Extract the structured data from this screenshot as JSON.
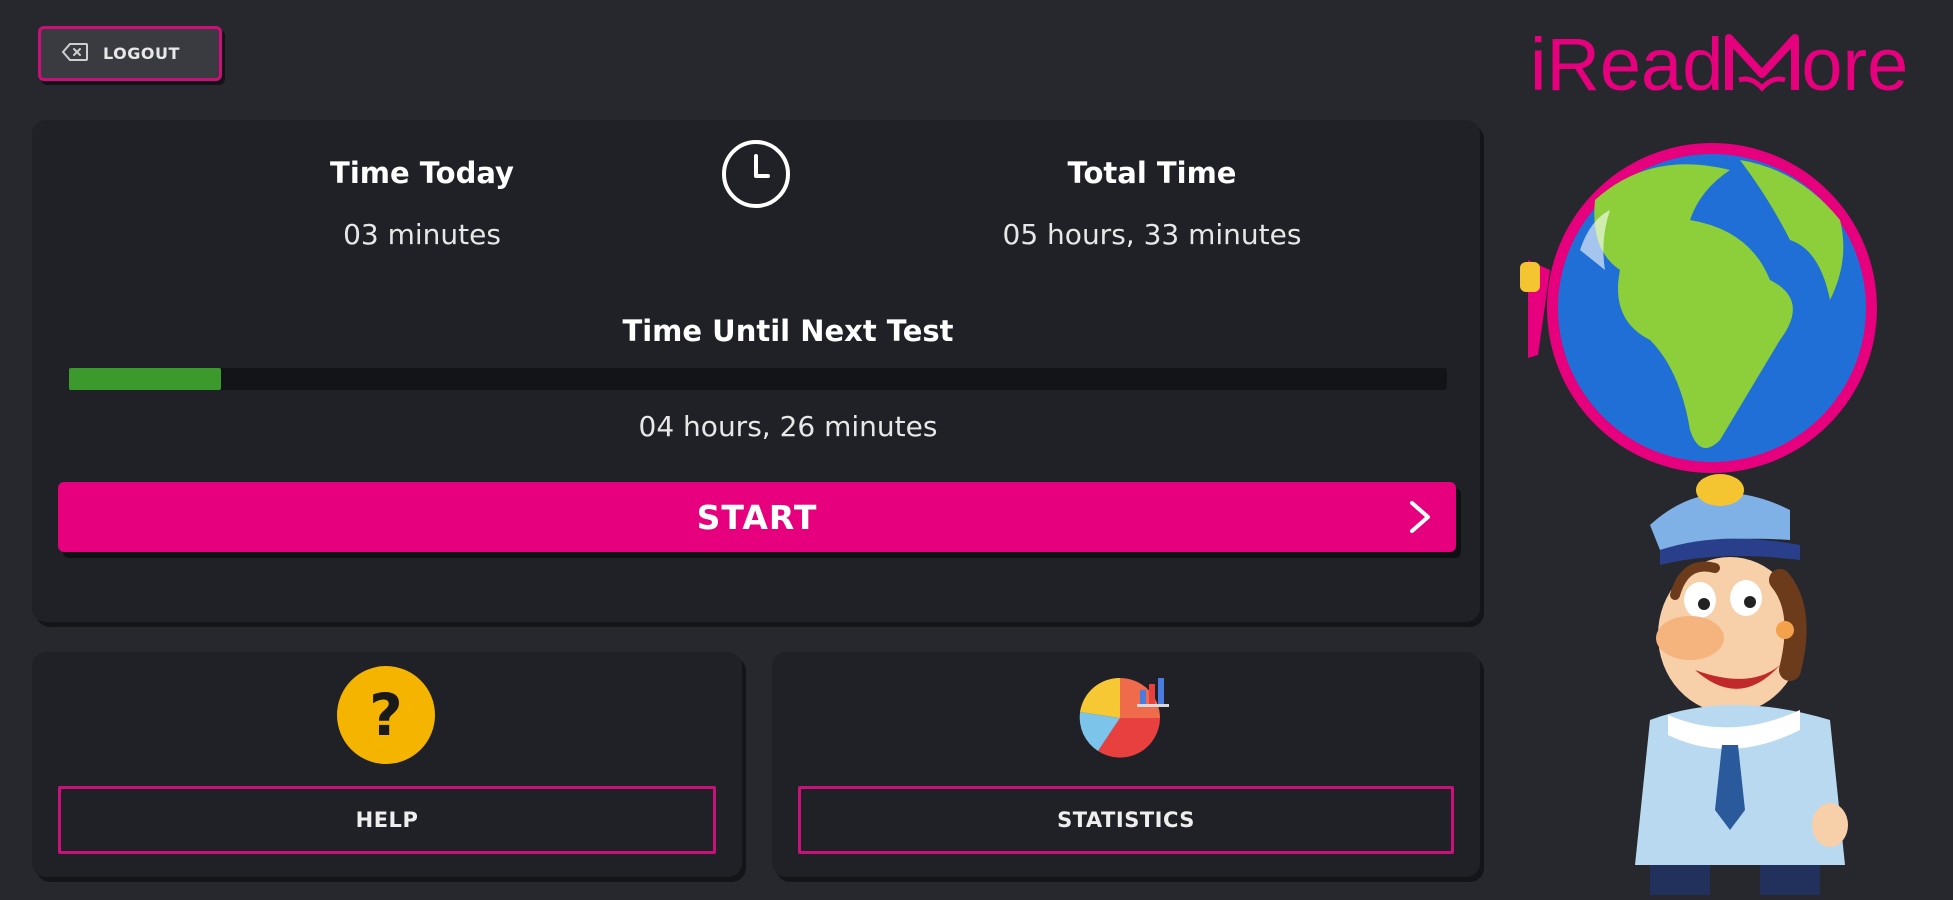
{
  "header": {
    "logout_label": "LOGOUT",
    "logo_text_before": "iRead",
    "logo_text_after": "ore"
  },
  "stats": {
    "time_today_label": "Time Today",
    "time_today_value": "03 minutes",
    "total_time_label": "Total Time",
    "total_time_value": "05 hours, 33 minutes",
    "next_test_label": "Time Until Next Test",
    "next_test_value": "04 hours, 26 minutes",
    "next_test_progress": 0.11
  },
  "actions": {
    "start_label": "START",
    "help_label": "HELP",
    "statistics_label": "STATISTICS"
  },
  "icons": {
    "logout": "backspace-icon",
    "clock": "clock-icon",
    "start": "chevron-right-icon",
    "help": "question-circle-icon",
    "statistics": "pie-chart-icon"
  },
  "colors": {
    "brand": "#e6007e",
    "background": "#26282d",
    "card": "#1f2126",
    "progress": "#3c9a2c",
    "help_icon": "#f4b400"
  }
}
